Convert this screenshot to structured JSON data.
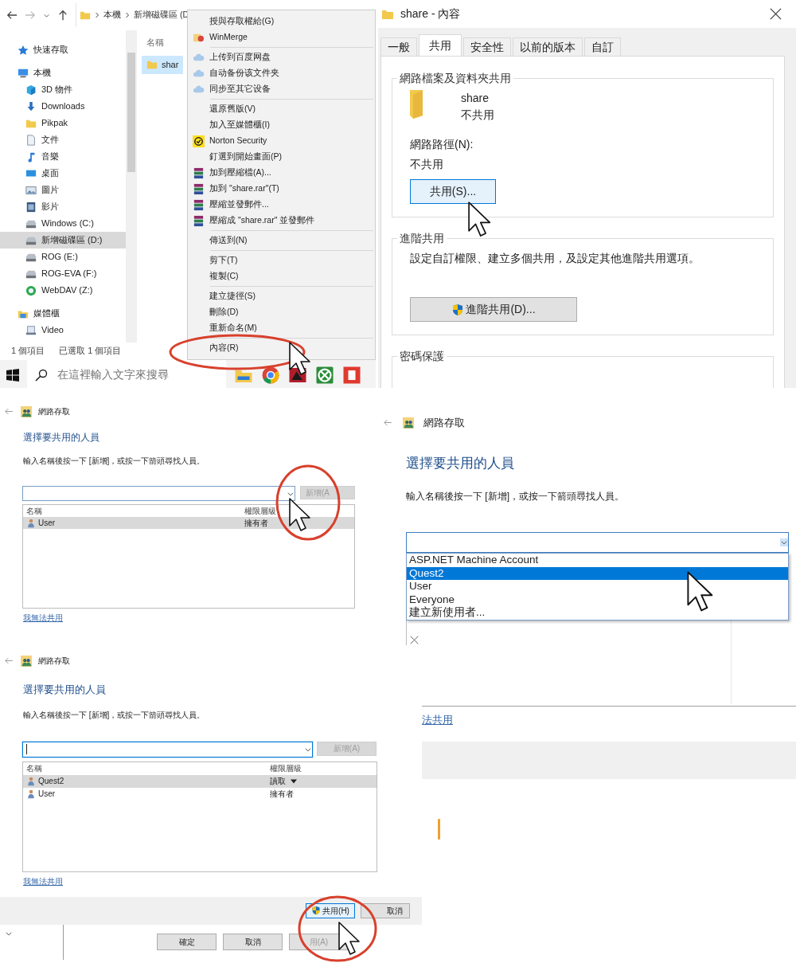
{
  "explorer": {
    "breadcrumb": [
      "本機",
      "新增磁碟區 (D"
    ],
    "sidebar": [
      {
        "label": "快速存取",
        "kind": "star",
        "selected": false
      },
      {
        "label": "本機",
        "kind": "pc",
        "selected": false,
        "children": [
          {
            "label": "3D 物件",
            "kind": "cube",
            "selected": false
          },
          {
            "label": "Downloads",
            "kind": "download",
            "selected": false
          },
          {
            "label": "Pikpak",
            "kind": "folder",
            "selected": false
          },
          {
            "label": "文件",
            "kind": "doc",
            "selected": false
          },
          {
            "label": "音樂",
            "kind": "music",
            "selected": false
          },
          {
            "label": "桌面",
            "kind": "desktop",
            "selected": false
          },
          {
            "label": "圖片",
            "kind": "picture",
            "selected": false
          },
          {
            "label": "影片",
            "kind": "video",
            "selected": false
          },
          {
            "label": "Windows (C:)",
            "kind": "drive",
            "selected": false
          },
          {
            "label": "新增磁碟區 (D:)",
            "kind": "drive",
            "selected": true
          },
          {
            "label": "ROG (E:)",
            "kind": "drive",
            "selected": false
          },
          {
            "label": "ROG-EVA (F:)",
            "kind": "drive",
            "selected": false
          },
          {
            "label": "WebDAV (Z:)",
            "kind": "globe",
            "selected": false
          }
        ]
      },
      {
        "label": "媒體櫃",
        "kind": "library",
        "selected": false,
        "children": [
          {
            "label": "Video",
            "kind": "libitem",
            "selected": false
          }
        ]
      }
    ],
    "column_header": "名稱",
    "files": [
      {
        "name": "shar",
        "selected": true
      }
    ],
    "status": [
      "1 個項目",
      "已選取 1 個項目"
    ],
    "context_menu": [
      [
        {
          "label": "授與存取權給(G)",
          "kind": "plain"
        },
        {
          "label": "WinMerge",
          "kind": "winmerge"
        }
      ],
      [
        {
          "label": "上传到百度网盘",
          "kind": "cloud"
        },
        {
          "label": "自动备份该文件夹",
          "kind": "cloud"
        },
        {
          "label": "同步至其它设备",
          "kind": "cloud"
        }
      ],
      [
        {
          "label": "還原舊版(V)",
          "kind": "plain"
        },
        {
          "label": "加入至媒體櫃(I)",
          "kind": "plain"
        },
        {
          "label": "Norton Security",
          "kind": "norton"
        },
        {
          "label": "釘選到開始畫面(P)",
          "kind": "plain"
        },
        {
          "label": "加到壓縮檔(A)...",
          "kind": "rar"
        },
        {
          "label": "加到 \"share.rar\"(T)",
          "kind": "rar"
        },
        {
          "label": "壓縮並發郵件...",
          "kind": "rar"
        },
        {
          "label": "壓縮成 \"share.rar\" 並發郵件",
          "kind": "rar"
        }
      ],
      [
        {
          "label": "傳送到(N)",
          "kind": "plain"
        }
      ],
      [
        {
          "label": "剪下(T)",
          "kind": "plain"
        },
        {
          "label": "複製(C)",
          "kind": "plain"
        }
      ],
      [
        {
          "label": "建立捷徑(S)",
          "kind": "plain"
        },
        {
          "label": "刪除(D)",
          "kind": "plain"
        },
        {
          "label": "重新命名(M)",
          "kind": "plain"
        }
      ],
      [
        {
          "label": "內容(R)",
          "kind": "plain"
        }
      ]
    ]
  },
  "taskbar": {
    "search": {
      "placeholder": "在這裡輸入文字來搜尋"
    },
    "apps": [
      {
        "kind": "files"
      },
      {
        "kind": "chrome"
      },
      {
        "kind": "redapp"
      },
      {
        "kind": "xbox"
      },
      {
        "kind": "redsq"
      }
    ]
  },
  "properties": {
    "title": "share - 內容",
    "tabs": [
      {
        "label": "一般",
        "selected": false
      },
      {
        "label": "共用",
        "selected": true
      },
      {
        "label": "安全性",
        "selected": false
      },
      {
        "label": "以前的版本",
        "selected": false
      },
      {
        "label": "自訂",
        "selected": false
      }
    ],
    "sharing": {
      "title": "網路檔案及資料夾共用",
      "name": "share",
      "state": "不共用",
      "path_label": "網路路徑(N):",
      "path": "不共用",
      "button": {
        "label": "共用(S)...",
        "focused": true
      }
    },
    "advanced": {
      "title": "進階共用",
      "description": "設定自訂權限、建立多個共用，及設定其他進階共用選項。",
      "button": {
        "label": "進階共用(D)...",
        "focused": false
      }
    },
    "password": {
      "title": "密碼保護"
    }
  },
  "access_dialogs": [
    {
      "header": "網路存取",
      "heading": "選擇要共用的人員",
      "instruction": "輸入名稱後按一下 [新增]，或按一下箭頭尋找人員。",
      "combo": {
        "focused": false,
        "open": false
      },
      "add_button": {
        "label": "新增(A",
        "disabled": true
      },
      "columns": [
        "名稱",
        "權限層級"
      ],
      "rows": [
        {
          "name": "User",
          "permission": "擁有者",
          "has_menu": false,
          "selected": true
        }
      ],
      "link": "我無法共用"
    },
    {
      "header": "網路存取",
      "heading": "選擇要共用的人員",
      "instruction": "輸入名稱後按一下 [新增]，或按一下箭頭尋找人員。",
      "combo": {
        "focused": false,
        "open": true
      },
      "options": [
        {
          "label": "ASP.NET Machine Account",
          "selected": false
        },
        {
          "label": "Quest2",
          "selected": true
        },
        {
          "label": "User",
          "selected": false
        },
        {
          "label": "Everyone",
          "selected": false
        },
        {
          "label": "建立新使用者...",
          "selected": false
        }
      ],
      "link": "法共用"
    },
    {
      "header": "網路存取",
      "heading": "選擇要共用的人員",
      "instruction": "輸入名稱後按一下 [新增]，或按一下箭頭尋找人員。",
      "combo": {
        "focused": true,
        "open": false
      },
      "add_button": {
        "label": "新增(A)",
        "disabled": true
      },
      "columns": [
        "名稱",
        "權限層級"
      ],
      "rows": [
        {
          "name": "Quest2",
          "permission": "讀取",
          "has_menu": true,
          "selected": true
        },
        {
          "name": "User",
          "permission": "擁有者",
          "has_menu": false,
          "selected": false
        }
      ],
      "link": "我無法共用",
      "footer_buttons": [
        {
          "label": "共用(H)",
          "shield": true,
          "focused": true
        },
        {
          "label": "取消",
          "shield": false,
          "focused": false
        }
      ],
      "parent_buttons": [
        {
          "label": "確定",
          "disabled": false
        },
        {
          "label": "取消",
          "disabled": false
        },
        {
          "label": "用(A)",
          "disabled": true
        }
      ]
    }
  ]
}
